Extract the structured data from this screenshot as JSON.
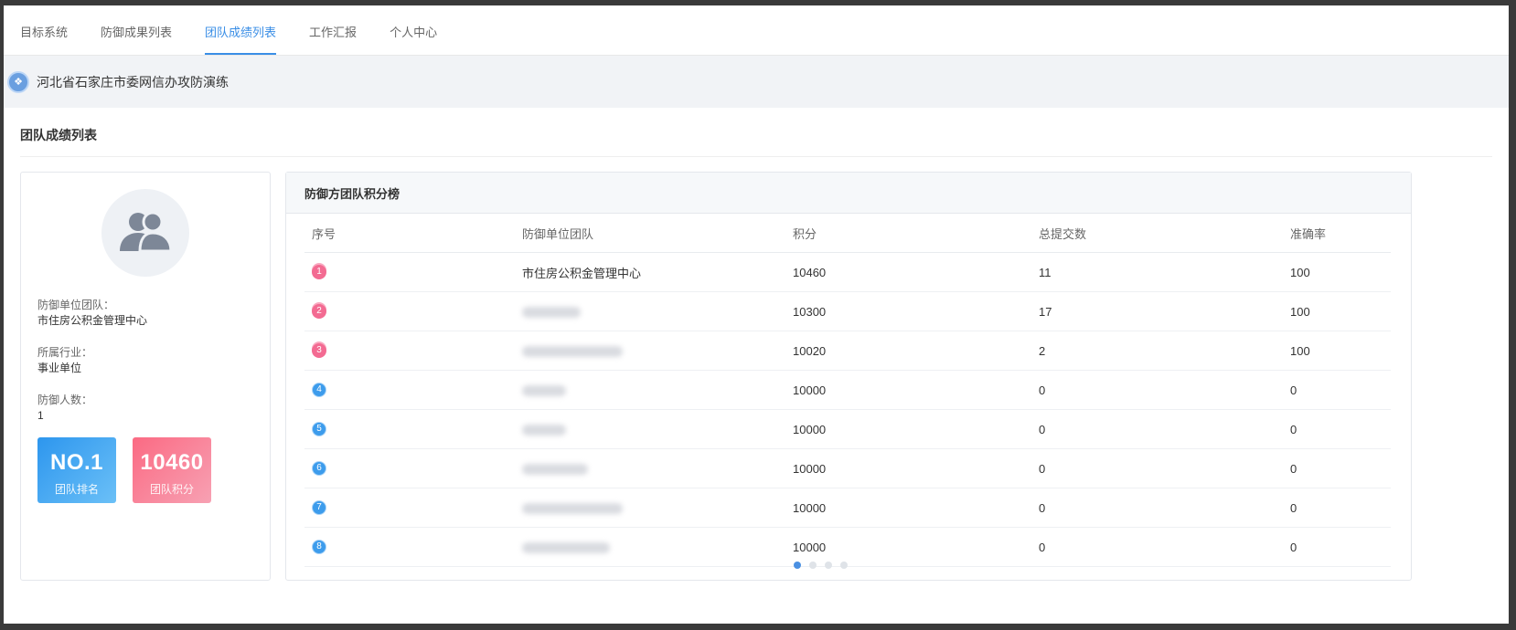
{
  "nav": {
    "tabs": [
      {
        "label": "目标系统",
        "active": false
      },
      {
        "label": "防御成果列表",
        "active": false
      },
      {
        "label": "团队成绩列表",
        "active": true
      },
      {
        "label": "工作汇报",
        "active": false
      },
      {
        "label": "个人中心",
        "active": false
      }
    ]
  },
  "breadcrumb": {
    "text": "河北省石家庄市委网信办攻防演练",
    "icon": "globe-icon"
  },
  "page": {
    "title": "团队成绩列表"
  },
  "profile": {
    "team_label": "防御单位团队：",
    "team_value": "市住房公积金管理中心",
    "industry_label": "所属行业：",
    "industry_value": "事业单位",
    "members_label": "防御人数：",
    "members_value": "1",
    "rank_value": "NO.1",
    "rank_label": "团队排名",
    "score_value": "10460",
    "score_label": "团队积分"
  },
  "leaderboard": {
    "title": "防御方团队积分榜",
    "columns": [
      "序号",
      "防御单位团队",
      "积分",
      "总提交数",
      "准确率"
    ],
    "rows": [
      {
        "rank": "1",
        "team": "市住房公积金管理中心",
        "score": "10460",
        "submissions": "11",
        "accuracy": "100"
      },
      {
        "rank": "2",
        "team": "",
        "score": "10300",
        "submissions": "17",
        "accuracy": "100"
      },
      {
        "rank": "3",
        "team": "",
        "score": "10020",
        "submissions": "2",
        "accuracy": "100"
      },
      {
        "rank": "4",
        "team": "",
        "score": "10000",
        "submissions": "0",
        "accuracy": "0"
      },
      {
        "rank": "5",
        "team": "",
        "score": "10000",
        "submissions": "0",
        "accuracy": "0"
      },
      {
        "rank": "6",
        "team": "",
        "score": "10000",
        "submissions": "0",
        "accuracy": "0"
      },
      {
        "rank": "7",
        "team": "",
        "score": "10000",
        "submissions": "0",
        "accuracy": "0"
      },
      {
        "rank": "8",
        "team": "",
        "score": "10000",
        "submissions": "0",
        "accuracy": "0"
      }
    ],
    "pagination": {
      "pages": 4,
      "current": 1
    }
  },
  "colors": {
    "accent": "#3a8ee6",
    "rank_card": "#2d96ee",
    "score_card": "#fb6a83",
    "medal_top": "#f36b92",
    "medal_rest": "#3d9cec"
  }
}
